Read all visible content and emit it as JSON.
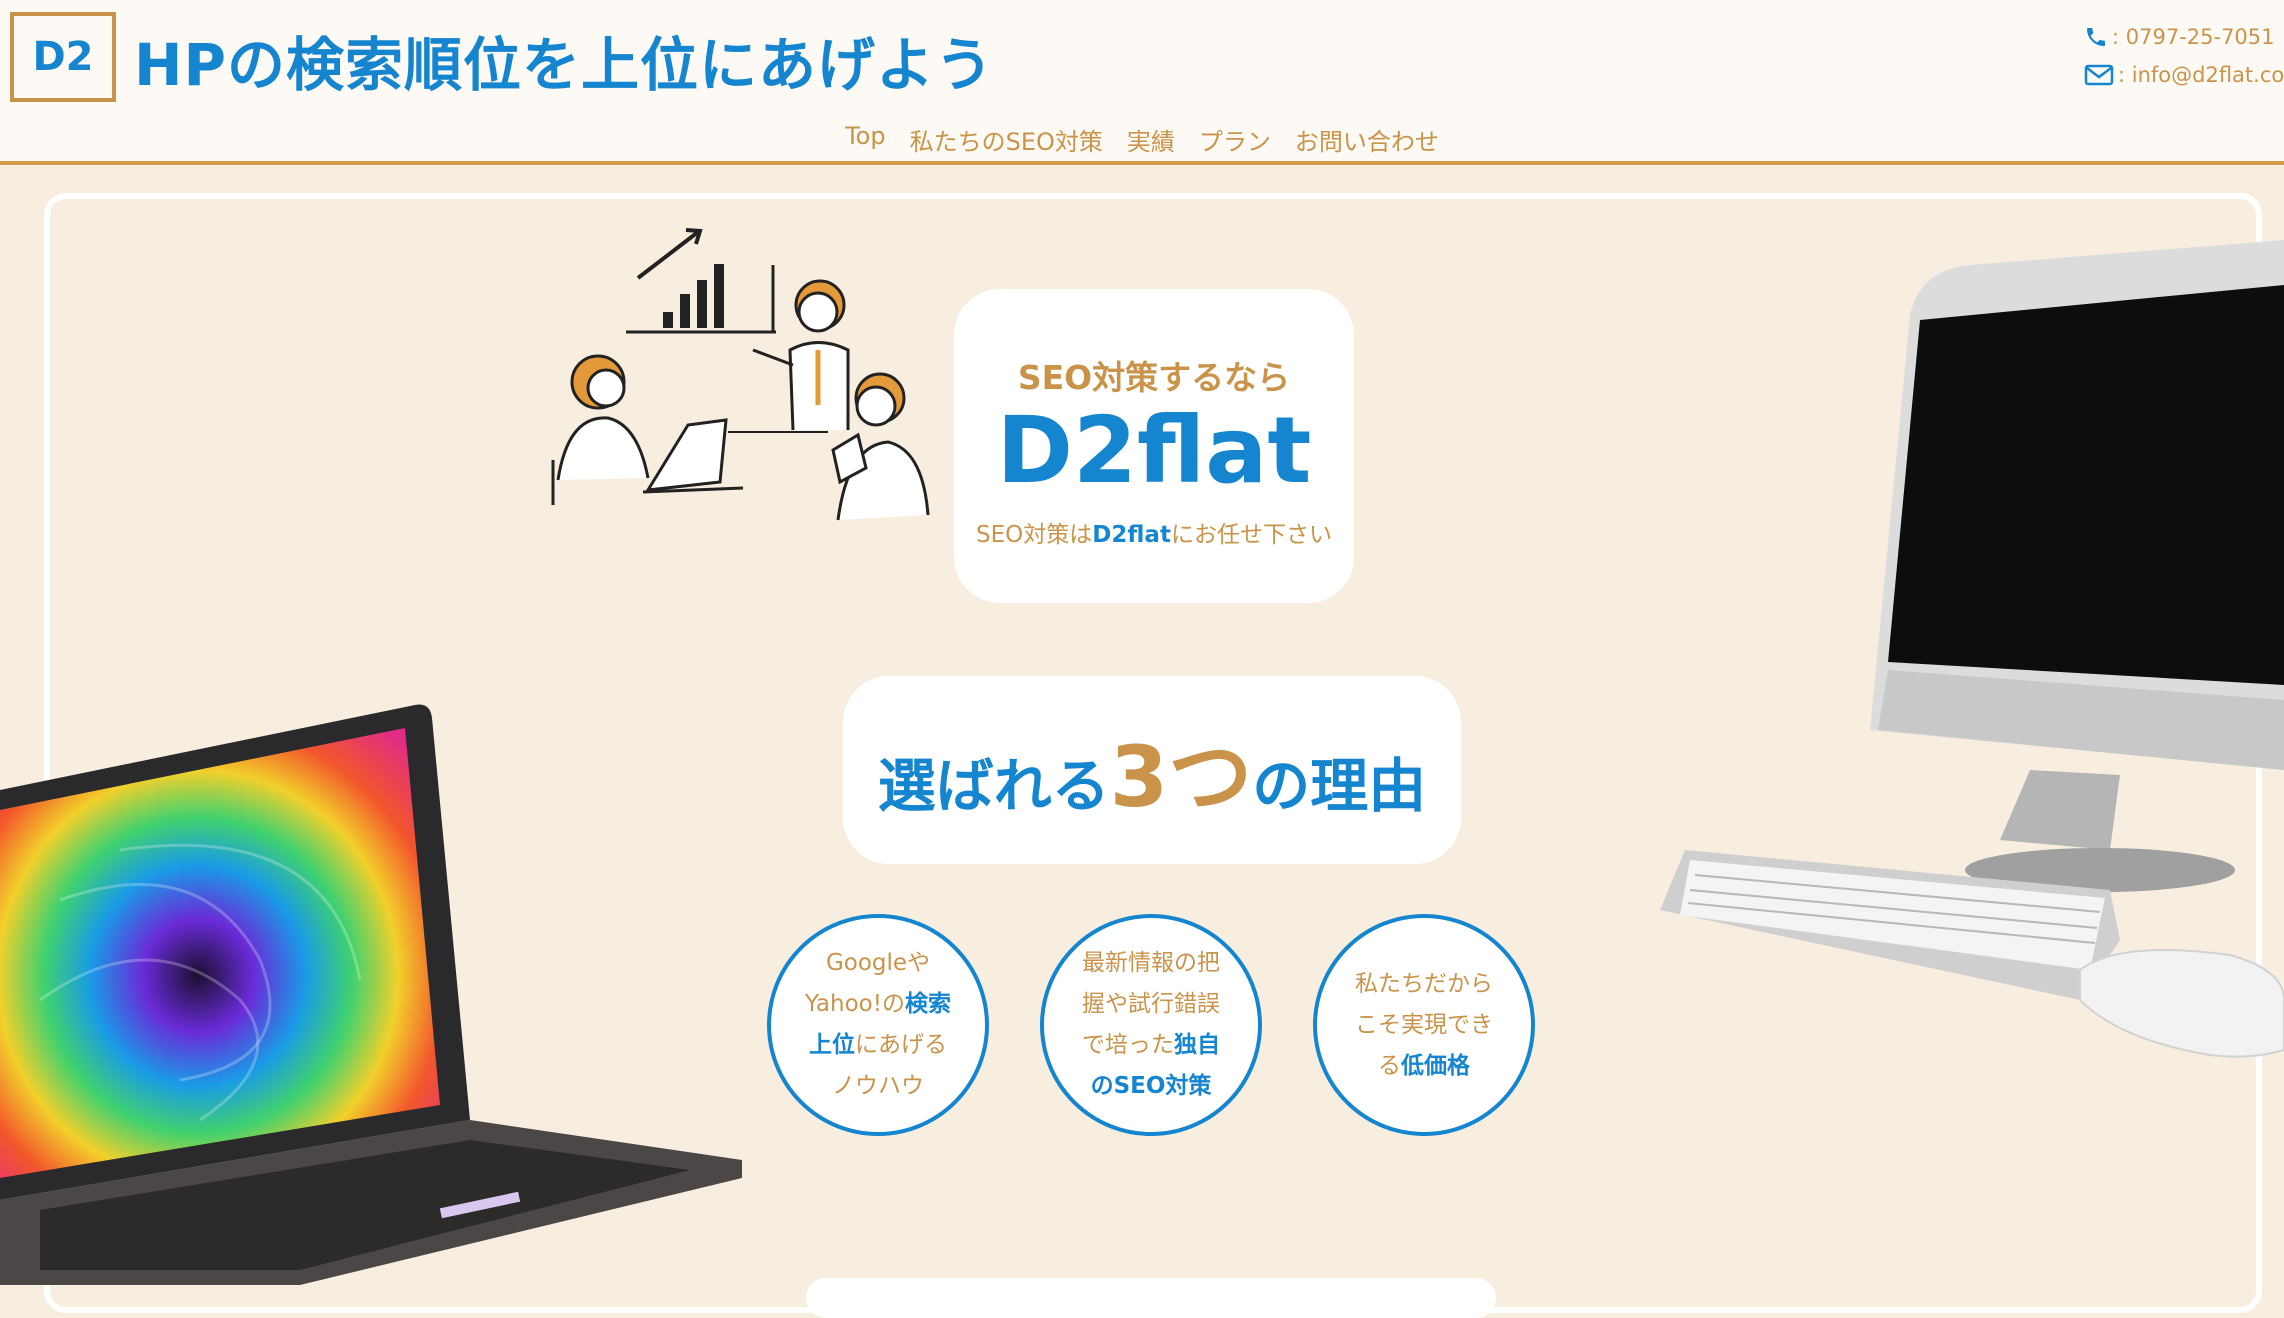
{
  "header": {
    "logo": "D2",
    "title": "HPの検索順位を上位にあげよう",
    "phone": ": 0797-25-7051",
    "email": ": info@d2flat.co",
    "phone_icon": "phone-icon",
    "email_icon": "mail-icon"
  },
  "nav": {
    "items": [
      "Top",
      "私たちのSEO対策",
      "実績",
      "プラン",
      "お問い合わせ"
    ]
  },
  "hero": {
    "subtitle": "SEO対策するなら",
    "brand": "D2flat",
    "tagline_pre": "SEO対策は",
    "tagline_brand": "D2flat",
    "tagline_post": "にお任せ下さい"
  },
  "reasons": {
    "title_pre": "選ばれる",
    "title_num": "3つ",
    "title_post": "の理由"
  },
  "points": [
    {
      "a": "Googleや",
      "b": "Yahoo!の",
      "c": "検索",
      "d": "上位",
      "e": "にあげる",
      "f": "ノウハウ"
    },
    {
      "a": "最新情報の把",
      "b": "握や試行錯誤",
      "c": "で培った",
      "d": "独自",
      "e": "のSEO対策"
    },
    {
      "a": "私たちだから",
      "b": "こそ実現でき",
      "c": "る",
      "d": "低価格"
    }
  ],
  "colors": {
    "blue": "#1585cf",
    "gold": "#c9944a",
    "background": "#f8eee0"
  }
}
